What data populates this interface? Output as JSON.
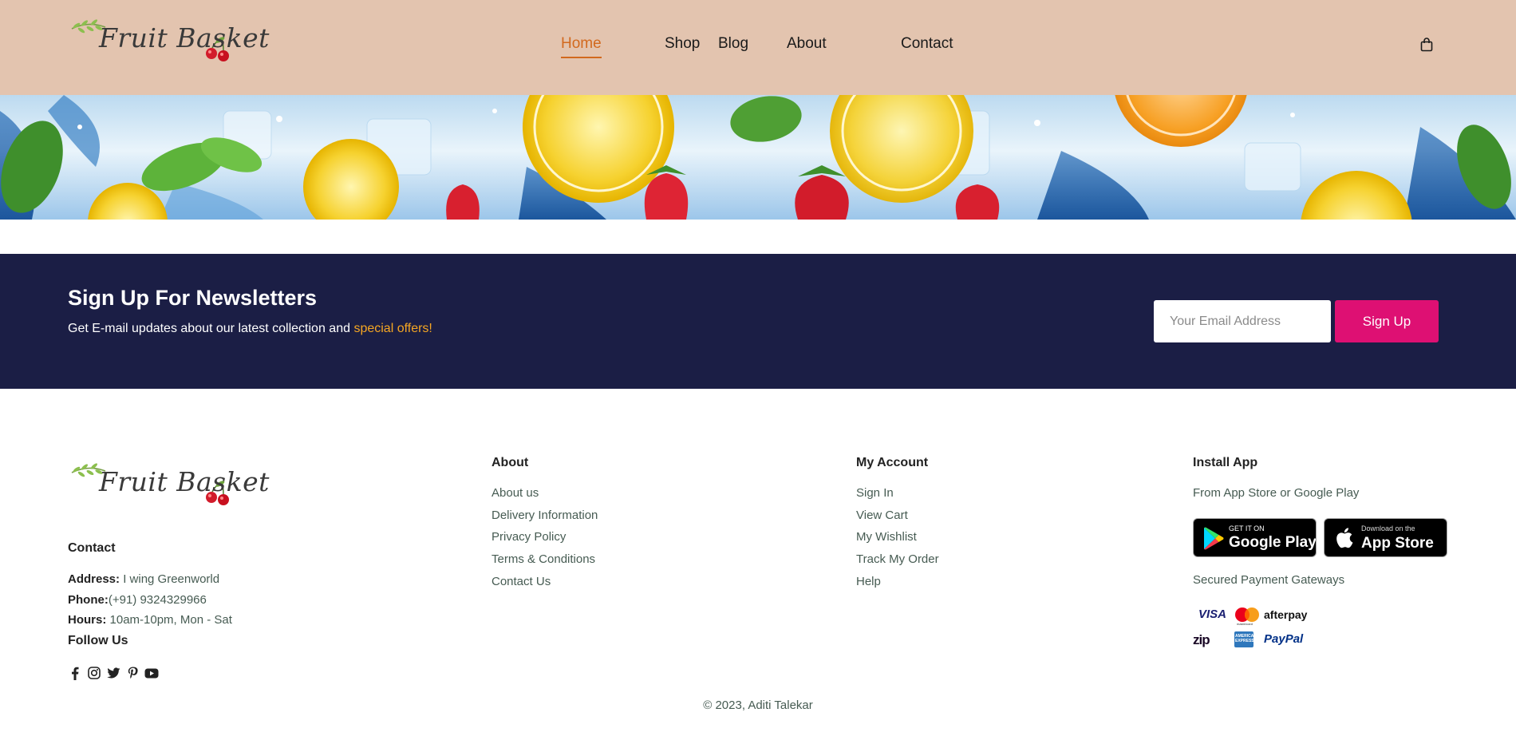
{
  "header": {
    "logo_text": "Fruit Basket",
    "nav": [
      {
        "label": "Home",
        "active": true
      },
      {
        "label": "Shop",
        "active": false
      },
      {
        "label": "Blog",
        "active": false
      },
      {
        "label": "About",
        "active": false
      },
      {
        "label": "Contact",
        "active": false
      }
    ],
    "cart_icon": "shopping-bag-icon",
    "accent_color": "#d2691e",
    "background_color": "#e3c4af"
  },
  "banner": {
    "description_icon": "fruit-splash-banner-image"
  },
  "newsletter": {
    "title": "Sign Up For Newsletters",
    "subtitle_prefix": "Get E-mail updates about our latest collection and",
    "subtitle_highlight": "special offers!",
    "email_placeholder": "Your Email Address",
    "button_label": "Sign Up",
    "background_color": "#1b1e45",
    "highlight_color": "#f5a623",
    "button_color": "#de1073"
  },
  "footer": {
    "logo_text": "Fruit Basket",
    "contact": {
      "heading": "Contact",
      "address_label": "Address:",
      "address_value": "I wing Greenworld",
      "phone_label": "Phone:",
      "phone_value": "(+91) 9324329966",
      "hours_label": "Hours:",
      "hours_value": "10am-10pm, Mon - Sat",
      "follow_heading": "Follow Us",
      "social_icons": [
        "facebook-icon",
        "instagram-icon",
        "twitter-icon",
        "pinterest-icon",
        "youtube-icon"
      ]
    },
    "about": {
      "heading": "About",
      "links": [
        "About us",
        "Delivery Information",
        "Privacy Policy",
        "Terms & Conditions",
        "Contact Us"
      ]
    },
    "account": {
      "heading": "My Account",
      "links": [
        "Sign In",
        "View Cart",
        "My Wishlist",
        "Track My Order",
        "Help"
      ]
    },
    "install": {
      "heading": "Install App",
      "subtitle": "From App Store or Google Play",
      "google_play_small": "GET IT ON",
      "google_play_big": "Google Play",
      "app_store_small": "Download on the",
      "app_store_big": "App Store",
      "payment_heading": "Secured Payment Gateways",
      "payment_methods": [
        "VISA",
        "mastercard",
        "afterpay",
        "zip",
        "AMERICAN EXPRESS",
        "PayPal"
      ]
    },
    "copyright": "© 2023, Aditi Talekar"
  }
}
